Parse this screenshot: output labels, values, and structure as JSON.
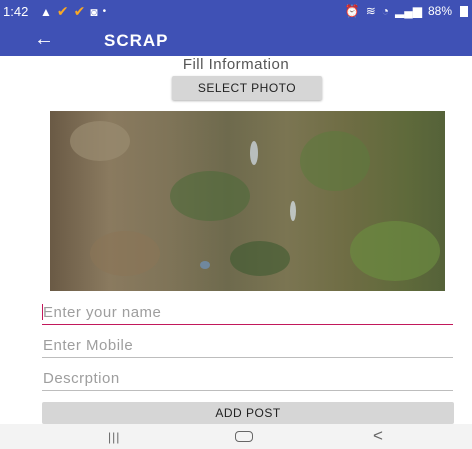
{
  "status_bar": {
    "time": "1:42",
    "battery": "88%",
    "icons": [
      "warning-icon",
      "check-icon",
      "check-icon",
      "notification-app-icon",
      "dot-icon",
      "alarm-icon",
      "vibrate-icon",
      "wifi-icon",
      "signal-icon",
      "battery-icon"
    ]
  },
  "app_bar": {
    "back_icon": "back-arrow-icon",
    "title": "SCRAP"
  },
  "form": {
    "heading": "Fill Information",
    "select_photo_label": "SELECT PHOTO",
    "name_placeholder": "Enter your name",
    "mobile_placeholder": "Enter Mobile",
    "description_placeholder": "Descrption",
    "add_post_label": "ADD POST"
  },
  "nav_bar": {
    "recent_icon": "recent-apps-icon",
    "home_icon": "home-icon",
    "back_icon": "back-icon"
  },
  "colors": {
    "primary": "#3f51b5",
    "accent": "#c2185b",
    "button": "#d6d6d6"
  }
}
